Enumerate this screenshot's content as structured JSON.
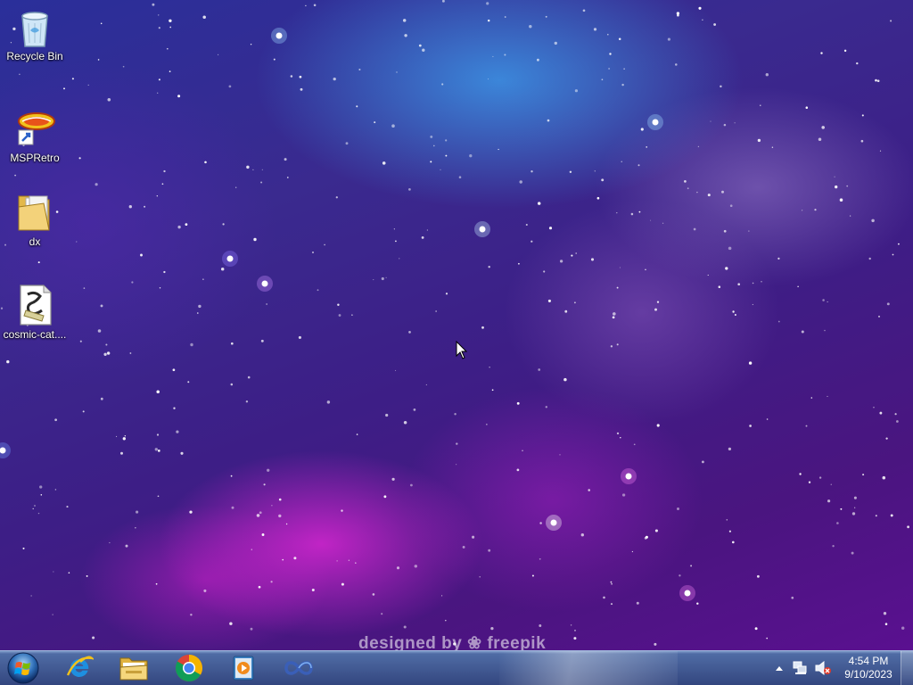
{
  "desktop": {
    "icons": [
      {
        "label": "Recycle Bin",
        "icon": "recycle-bin-icon"
      },
      {
        "label": "MSPRetro",
        "icon": "msp-retro-icon"
      },
      {
        "label": "dx",
        "icon": "folder-icon"
      },
      {
        "label": "cosmic-cat....",
        "icon": "script-file-icon"
      }
    ],
    "watermark": "designed by ❀ freepik"
  },
  "taskbar": {
    "start": {
      "icon": "windows-start-icon"
    },
    "pinned": [
      {
        "name": "Internet Explorer",
        "icon": "internet-explorer-icon"
      },
      {
        "name": "File Explorer",
        "icon": "file-explorer-icon"
      },
      {
        "name": "Google Chrome",
        "icon": "chrome-icon"
      },
      {
        "name": "Media Player",
        "icon": "media-player-icon"
      },
      {
        "name": "App",
        "icon": "infinity-app-icon"
      }
    ],
    "tray": {
      "time": "4:54 PM",
      "date": "9/10/2023"
    }
  },
  "colors": {
    "taskbar": "#2c3e78",
    "accent_magenta": "#e62ad8",
    "accent_blue": "#3c96e6"
  }
}
